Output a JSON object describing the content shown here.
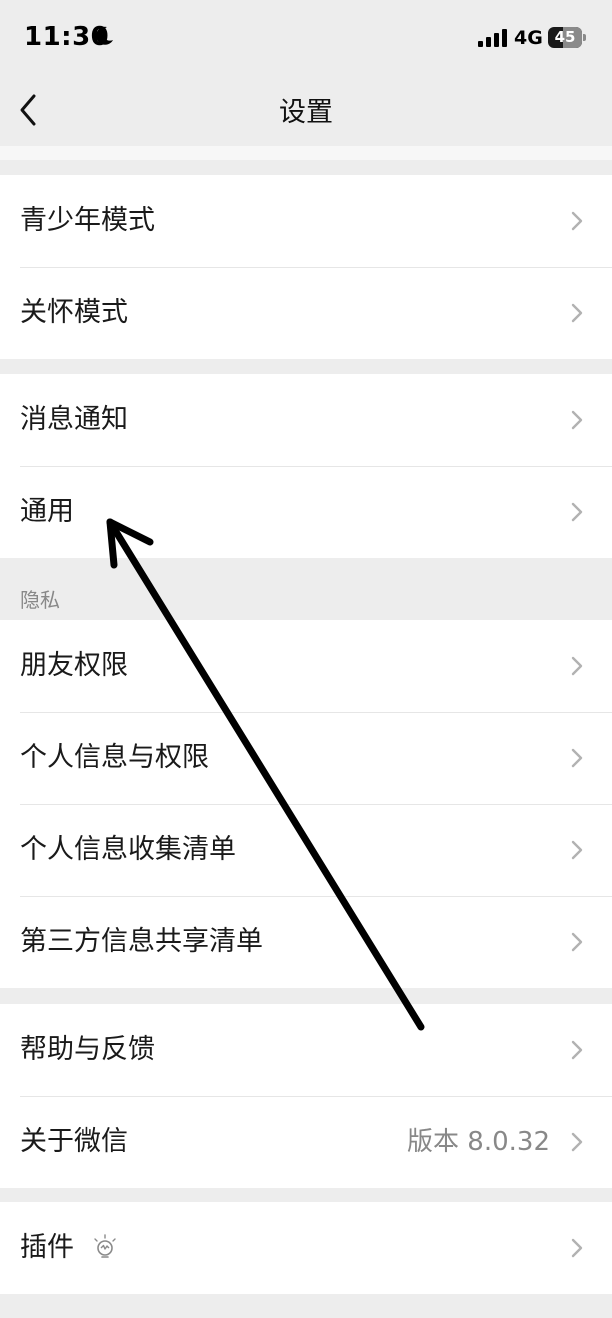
{
  "status_bar": {
    "time": "11:30",
    "network": "4G",
    "battery": "45",
    "battery_level": 0.45,
    "icons": [
      "moon-icon",
      "signal-icon",
      "battery-icon"
    ]
  },
  "nav": {
    "title": "设置",
    "back_icon": "chevron-left-icon"
  },
  "groups": [
    {
      "items": [
        {
          "label": "青少年模式"
        },
        {
          "label": "关怀模式"
        }
      ]
    },
    {
      "items": [
        {
          "label": "消息通知"
        },
        {
          "label": "通用"
        }
      ]
    },
    {
      "header": "隐私",
      "items": [
        {
          "label": "朋友权限"
        },
        {
          "label": "个人信息与权限"
        },
        {
          "label": "个人信息收集清单"
        },
        {
          "label": "第三方信息共享清单"
        }
      ]
    },
    {
      "items": [
        {
          "label": "帮助与反馈"
        },
        {
          "label": "关于微信",
          "value": "版本 8.0.32"
        }
      ]
    },
    {
      "items": [
        {
          "label": "插件",
          "icon": "lightbulb-icon"
        }
      ]
    }
  ],
  "colors": {
    "background": "#ededed",
    "card": "#ffffff",
    "text": "#1a1a1a",
    "secondary_text": "#888888",
    "chevron": "#b2b2b2",
    "annotation_arrow": "#000000"
  }
}
